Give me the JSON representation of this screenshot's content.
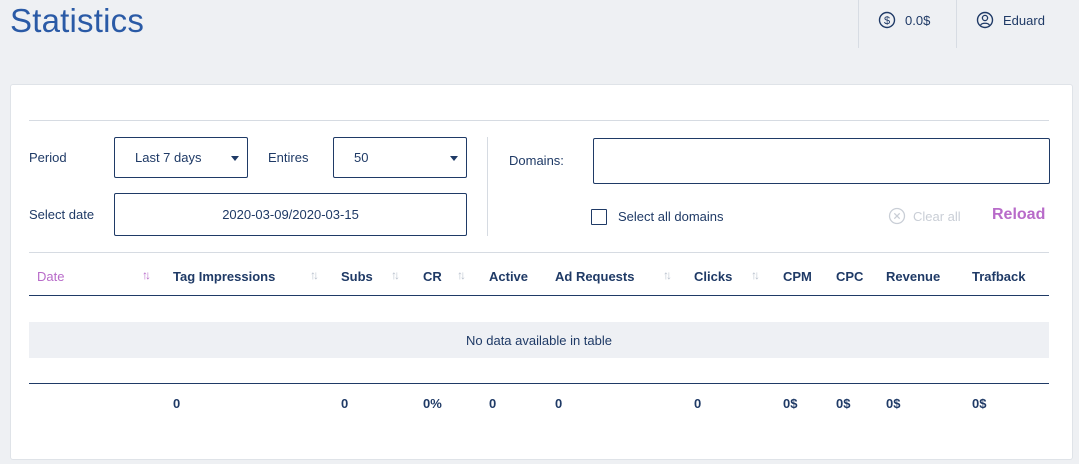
{
  "header": {
    "title": "Statistics",
    "balance": "0.0$",
    "balance_icon": "dollar-circle-icon",
    "user_name": "Eduard",
    "user_icon": "user-circle-icon"
  },
  "filters": {
    "period_label": "Period",
    "period_value": "Last 7 days",
    "entries_label": "Entires",
    "entries_value": "50",
    "date_label": "Select date",
    "date_value": "2020-03-09/2020-03-15",
    "domains_label": "Domains:",
    "domains_value": "",
    "select_all_label": "Select all domains",
    "clear_all_label": "Clear all",
    "reload_label": "Reload"
  },
  "table": {
    "columns": [
      "Date",
      "Tag Impressions",
      "Subs",
      "CR",
      "Active",
      "Ad Requests",
      "Clicks",
      "CPM",
      "CPC",
      "Revenue",
      "Trafback"
    ],
    "empty_text": "No data available in table",
    "footer": [
      "0",
      "0",
      "0%",
      "0",
      "0",
      "0",
      "0$",
      "0$",
      "0$",
      "0$"
    ]
  },
  "colors": {
    "title": "#2a5aa6",
    "accent": "#b86bc9",
    "text": "#1f3a66"
  }
}
